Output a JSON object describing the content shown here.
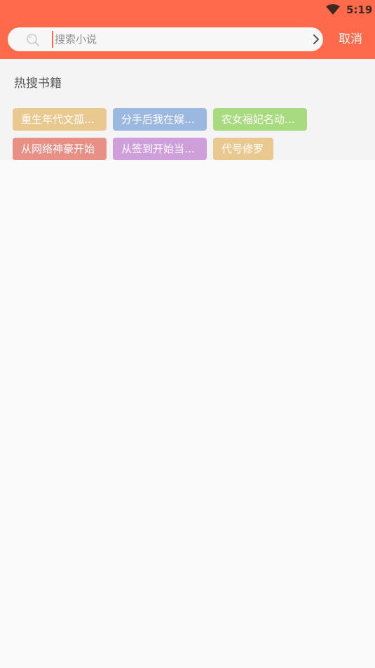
{
  "status_bar": {
    "time": "5:19",
    "wifi_icon": "wifi-icon"
  },
  "search": {
    "placeholder": "搜索小说",
    "value": "",
    "search_icon": "search-icon",
    "submit_icon": "chevron-right-icon",
    "cancel_label": "取消"
  },
  "hot": {
    "title": "热搜书籍",
    "tags": [
      {
        "label": "重生年代文孤…",
        "color": "#e9c98f"
      },
      {
        "label": "分手后我在娱…",
        "color": "#9bb9e0"
      },
      {
        "label": "农女福妃名动…",
        "color": "#a8db7f"
      },
      {
        "label": "从网络神豪开始",
        "color": "#e88f86"
      },
      {
        "label": "从签到开始当…",
        "color": "#cf9fdc"
      },
      {
        "label": "代号修罗",
        "color": "#e9c98f"
      }
    ]
  },
  "colors": {
    "header": "#ff6b4a",
    "cursor": "#ff6b4a"
  }
}
